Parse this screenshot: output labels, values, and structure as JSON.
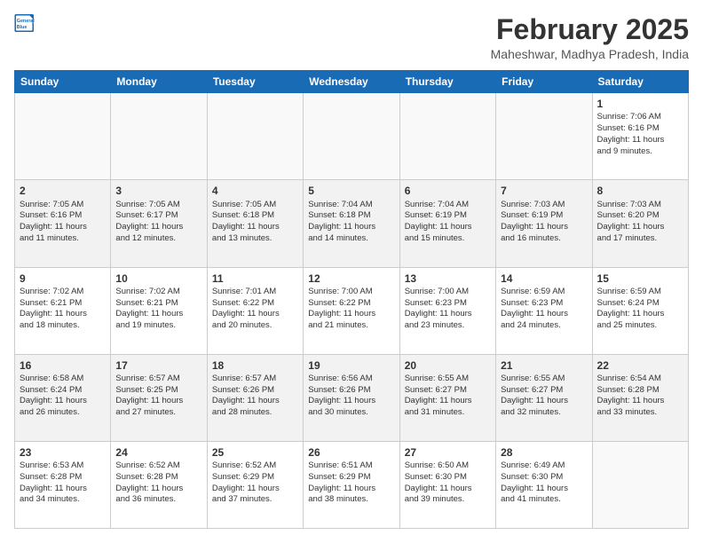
{
  "logo": {
    "line1": "General",
    "line2": "Blue"
  },
  "header": {
    "month_year": "February 2025",
    "location": "Maheshwar, Madhya Pradesh, India"
  },
  "weekdays": [
    "Sunday",
    "Monday",
    "Tuesday",
    "Wednesday",
    "Thursday",
    "Friday",
    "Saturday"
  ],
  "weeks": [
    [
      {
        "day": "",
        "info": ""
      },
      {
        "day": "",
        "info": ""
      },
      {
        "day": "",
        "info": ""
      },
      {
        "day": "",
        "info": ""
      },
      {
        "day": "",
        "info": ""
      },
      {
        "day": "",
        "info": ""
      },
      {
        "day": "1",
        "info": "Sunrise: 7:06 AM\nSunset: 6:16 PM\nDaylight: 11 hours\nand 9 minutes."
      }
    ],
    [
      {
        "day": "2",
        "info": "Sunrise: 7:05 AM\nSunset: 6:16 PM\nDaylight: 11 hours\nand 11 minutes."
      },
      {
        "day": "3",
        "info": "Sunrise: 7:05 AM\nSunset: 6:17 PM\nDaylight: 11 hours\nand 12 minutes."
      },
      {
        "day": "4",
        "info": "Sunrise: 7:05 AM\nSunset: 6:18 PM\nDaylight: 11 hours\nand 13 minutes."
      },
      {
        "day": "5",
        "info": "Sunrise: 7:04 AM\nSunset: 6:18 PM\nDaylight: 11 hours\nand 14 minutes."
      },
      {
        "day": "6",
        "info": "Sunrise: 7:04 AM\nSunset: 6:19 PM\nDaylight: 11 hours\nand 15 minutes."
      },
      {
        "day": "7",
        "info": "Sunrise: 7:03 AM\nSunset: 6:19 PM\nDaylight: 11 hours\nand 16 minutes."
      },
      {
        "day": "8",
        "info": "Sunrise: 7:03 AM\nSunset: 6:20 PM\nDaylight: 11 hours\nand 17 minutes."
      }
    ],
    [
      {
        "day": "9",
        "info": "Sunrise: 7:02 AM\nSunset: 6:21 PM\nDaylight: 11 hours\nand 18 minutes."
      },
      {
        "day": "10",
        "info": "Sunrise: 7:02 AM\nSunset: 6:21 PM\nDaylight: 11 hours\nand 19 minutes."
      },
      {
        "day": "11",
        "info": "Sunrise: 7:01 AM\nSunset: 6:22 PM\nDaylight: 11 hours\nand 20 minutes."
      },
      {
        "day": "12",
        "info": "Sunrise: 7:00 AM\nSunset: 6:22 PM\nDaylight: 11 hours\nand 21 minutes."
      },
      {
        "day": "13",
        "info": "Sunrise: 7:00 AM\nSunset: 6:23 PM\nDaylight: 11 hours\nand 23 minutes."
      },
      {
        "day": "14",
        "info": "Sunrise: 6:59 AM\nSunset: 6:23 PM\nDaylight: 11 hours\nand 24 minutes."
      },
      {
        "day": "15",
        "info": "Sunrise: 6:59 AM\nSunset: 6:24 PM\nDaylight: 11 hours\nand 25 minutes."
      }
    ],
    [
      {
        "day": "16",
        "info": "Sunrise: 6:58 AM\nSunset: 6:24 PM\nDaylight: 11 hours\nand 26 minutes."
      },
      {
        "day": "17",
        "info": "Sunrise: 6:57 AM\nSunset: 6:25 PM\nDaylight: 11 hours\nand 27 minutes."
      },
      {
        "day": "18",
        "info": "Sunrise: 6:57 AM\nSunset: 6:26 PM\nDaylight: 11 hours\nand 28 minutes."
      },
      {
        "day": "19",
        "info": "Sunrise: 6:56 AM\nSunset: 6:26 PM\nDaylight: 11 hours\nand 30 minutes."
      },
      {
        "day": "20",
        "info": "Sunrise: 6:55 AM\nSunset: 6:27 PM\nDaylight: 11 hours\nand 31 minutes."
      },
      {
        "day": "21",
        "info": "Sunrise: 6:55 AM\nSunset: 6:27 PM\nDaylight: 11 hours\nand 32 minutes."
      },
      {
        "day": "22",
        "info": "Sunrise: 6:54 AM\nSunset: 6:28 PM\nDaylight: 11 hours\nand 33 minutes."
      }
    ],
    [
      {
        "day": "23",
        "info": "Sunrise: 6:53 AM\nSunset: 6:28 PM\nDaylight: 11 hours\nand 34 minutes."
      },
      {
        "day": "24",
        "info": "Sunrise: 6:52 AM\nSunset: 6:28 PM\nDaylight: 11 hours\nand 36 minutes."
      },
      {
        "day": "25",
        "info": "Sunrise: 6:52 AM\nSunset: 6:29 PM\nDaylight: 11 hours\nand 37 minutes."
      },
      {
        "day": "26",
        "info": "Sunrise: 6:51 AM\nSunset: 6:29 PM\nDaylight: 11 hours\nand 38 minutes."
      },
      {
        "day": "27",
        "info": "Sunrise: 6:50 AM\nSunset: 6:30 PM\nDaylight: 11 hours\nand 39 minutes."
      },
      {
        "day": "28",
        "info": "Sunrise: 6:49 AM\nSunset: 6:30 PM\nDaylight: 11 hours\nand 41 minutes."
      },
      {
        "day": "",
        "info": ""
      }
    ]
  ]
}
